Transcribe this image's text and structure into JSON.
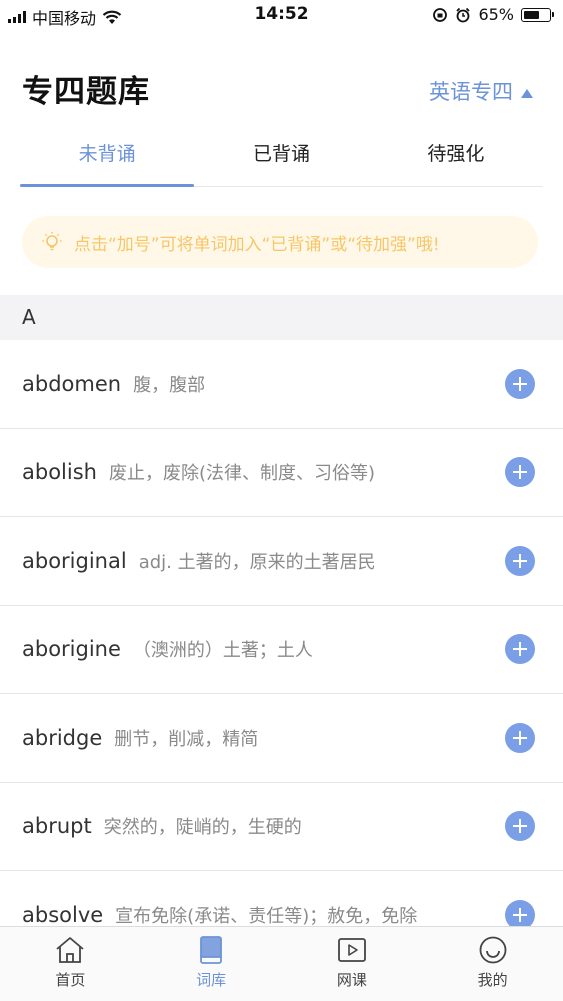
{
  "status_bar": {
    "carrier": "中国移动",
    "time": "14:52",
    "battery": "65%",
    "battery_level": 0.65
  },
  "header": {
    "title": "专四题库",
    "level_select": "英语专四"
  },
  "tabs": [
    {
      "label": "未背诵",
      "active": true
    },
    {
      "label": "已背诵",
      "active": false
    },
    {
      "label": "待强化",
      "active": false
    }
  ],
  "tip": {
    "text": "点击“加号”可将单词加入“已背诵”或“待加强”哦!",
    "icon": "bulb-icon",
    "color": "#f6c66a"
  },
  "section": {
    "letter": "A"
  },
  "words": [
    {
      "word": "abdomen",
      "meaning": "腹，腹部"
    },
    {
      "word": "abolish",
      "meaning": "废止，废除(法律、制度、习俗等)"
    },
    {
      "word": "aboriginal",
      "meaning": "adj. 土著的，原来的土著居民"
    },
    {
      "word": "aborigine",
      "meaning": "（澳洲的）土著；土人"
    },
    {
      "word": "abridge",
      "meaning": "删节，削减，精简"
    },
    {
      "word": "abrupt",
      "meaning": "突然的，陡峭的，生硬的"
    },
    {
      "word": "absolve",
      "meaning": "宣布免除(承诺、责任等)；赦免，免除"
    }
  ],
  "bottom_nav": [
    {
      "label": "首页",
      "icon": "home-icon",
      "active": false
    },
    {
      "label": "词库",
      "icon": "book-icon",
      "active": true
    },
    {
      "label": "网课",
      "icon": "video-icon",
      "active": false
    },
    {
      "label": "我的",
      "icon": "profile-icon",
      "active": false
    }
  ],
  "colors": {
    "accent": "#6c93d8",
    "plus_button": "#7b9fe6",
    "tip_bg": "#fff8e8"
  }
}
